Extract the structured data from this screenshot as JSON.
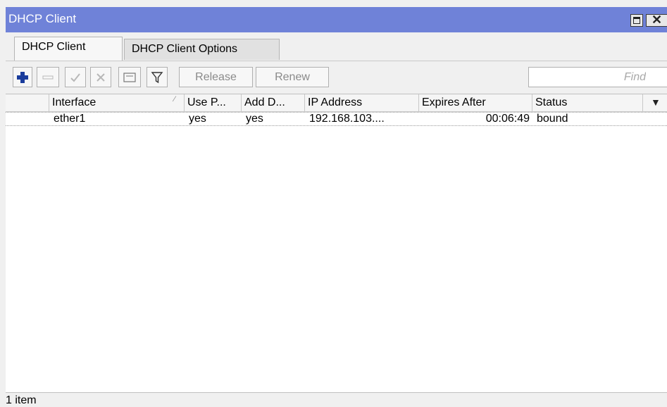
{
  "window": {
    "title": "DHCP Client"
  },
  "tabs": [
    {
      "label": "DHCP Client",
      "active": true
    },
    {
      "label": "DHCP Client Options",
      "active": false
    }
  ],
  "toolbar": {
    "add_icon": "plus-icon",
    "remove_icon": "minus-icon",
    "enable_icon": "check-icon",
    "disable_icon": "cross-icon",
    "comment_icon": "comment-icon",
    "filter_icon": "filter-icon",
    "release_label": "Release",
    "renew_label": "Renew",
    "find_placeholder": "Find"
  },
  "table": {
    "columns": [
      "Interface",
      "Use P...",
      "Add D...",
      "IP Address",
      "Expires After",
      "Status"
    ],
    "rows": [
      {
        "interface": "ether1",
        "use_peer": "yes",
        "add_default": "yes",
        "ip_address": "192.168.103....",
        "expires_after": "00:06:49",
        "status": "bound"
      }
    ]
  },
  "status_bar": {
    "item_count": "1 item"
  },
  "colors": {
    "titlebar": "#6f82d8",
    "add_icon": "#1a3c9c"
  }
}
